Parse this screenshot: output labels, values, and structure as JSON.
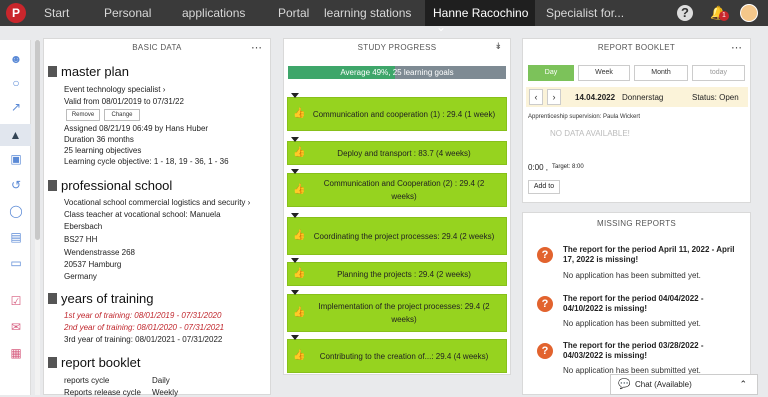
{
  "nav": {
    "logo": "P",
    "items": [
      "Start",
      "Personal",
      "applications",
      "Portal",
      "learning stations"
    ],
    "user": "Hanne Racochino",
    "specialist": "Specialist for...",
    "help": "?",
    "notification_count": "1"
  },
  "basic_data": {
    "title": "BASIC DATA",
    "master_plan": {
      "heading": "master plan",
      "profession": "Event technology specialist",
      "valid": "Valid from 08/01/2019 to 07/31/22",
      "remove_label": "Remove",
      "change_label": "Change",
      "assigned": "Assigned 08/21/19 06:49 by Hans Huber",
      "duration": "Duration 36 months",
      "objectives": "25 learning objectives",
      "cycle_objective": "Learning cycle objective: 1 - 18, 19 - 36, 1 - 36"
    },
    "school": {
      "heading": "professional school",
      "name": "Vocational school commercial logistics and security",
      "teacher_1": "Class teacher at vocational school: Manuela",
      "teacher_2": "Ebersbach",
      "class": "BS27 HH",
      "street": "Wendenstrasse 268",
      "city": "20537 Hamburg",
      "country": "Germany"
    },
    "years": {
      "heading": "years of training",
      "y1": "1st year of training: 08/01/2019 - 07/31/2020",
      "y2": "2nd year of training: 08/01/2020 - 07/31/2021",
      "y3": "3rd year of training: 08/01/2021 - 07/31/2022"
    },
    "booklet": {
      "heading": "report booklet",
      "cycle_label": "reports cycle",
      "cycle_value": "Daily",
      "release_label": "Reports release cycle",
      "release_value": "Weekly"
    }
  },
  "study_progress": {
    "title": "STUDY PROGRESS",
    "average_text": "Average 49%, 25 learning goals",
    "average_percent": 49,
    "goals": [
      {
        "label": "Communication and cooperation (1) : 29.4 (1 week)"
      },
      {
        "label": "Deploy and transport : 83.7 (4 weeks)"
      },
      {
        "label": "Communication and Cooperation (2) : 29.4 (2 weeks)"
      },
      {
        "label": "Coordinating the project processes: 29.4 (2 weeks)"
      },
      {
        "label": "Planning the projects : 29.4 (2 weeks)"
      },
      {
        "label": "Implementation of the project processes: 29.4 (2 weeks)"
      },
      {
        "label": "Contributing to the creation of...: 29.4 (4 weeks)"
      }
    ]
  },
  "report_booklet": {
    "title": "REPORT BOOKLET",
    "tabs": [
      "Day",
      "Week",
      "Month",
      "today"
    ],
    "date": "14.04.2022",
    "weekday": "Donnerstag",
    "status": "Status: Open",
    "supervision": "Apprenticeship supervision: Paula Wickert",
    "no_data": "NO DATA AVAILABLE!",
    "time": "0:00 ,",
    "target": "Target: 8:00",
    "add_label": "Add to"
  },
  "missing_reports": {
    "title": "MISSING REPORTS",
    "items": [
      {
        "title": "The report for the period April 11, 2022 - April 17, 2022 is missing!",
        "sub": "No application has been submitted yet."
      },
      {
        "title": "The report for the period 04/04/2022 - 04/10/2022 is missing!",
        "sub": "No application has been submitted yet."
      },
      {
        "title": "The report for the period 03/28/2022 - 04/03/2022 is missing!",
        "sub": "No application has been submitted yet."
      }
    ]
  },
  "chat": {
    "label": "Chat (Available)"
  }
}
